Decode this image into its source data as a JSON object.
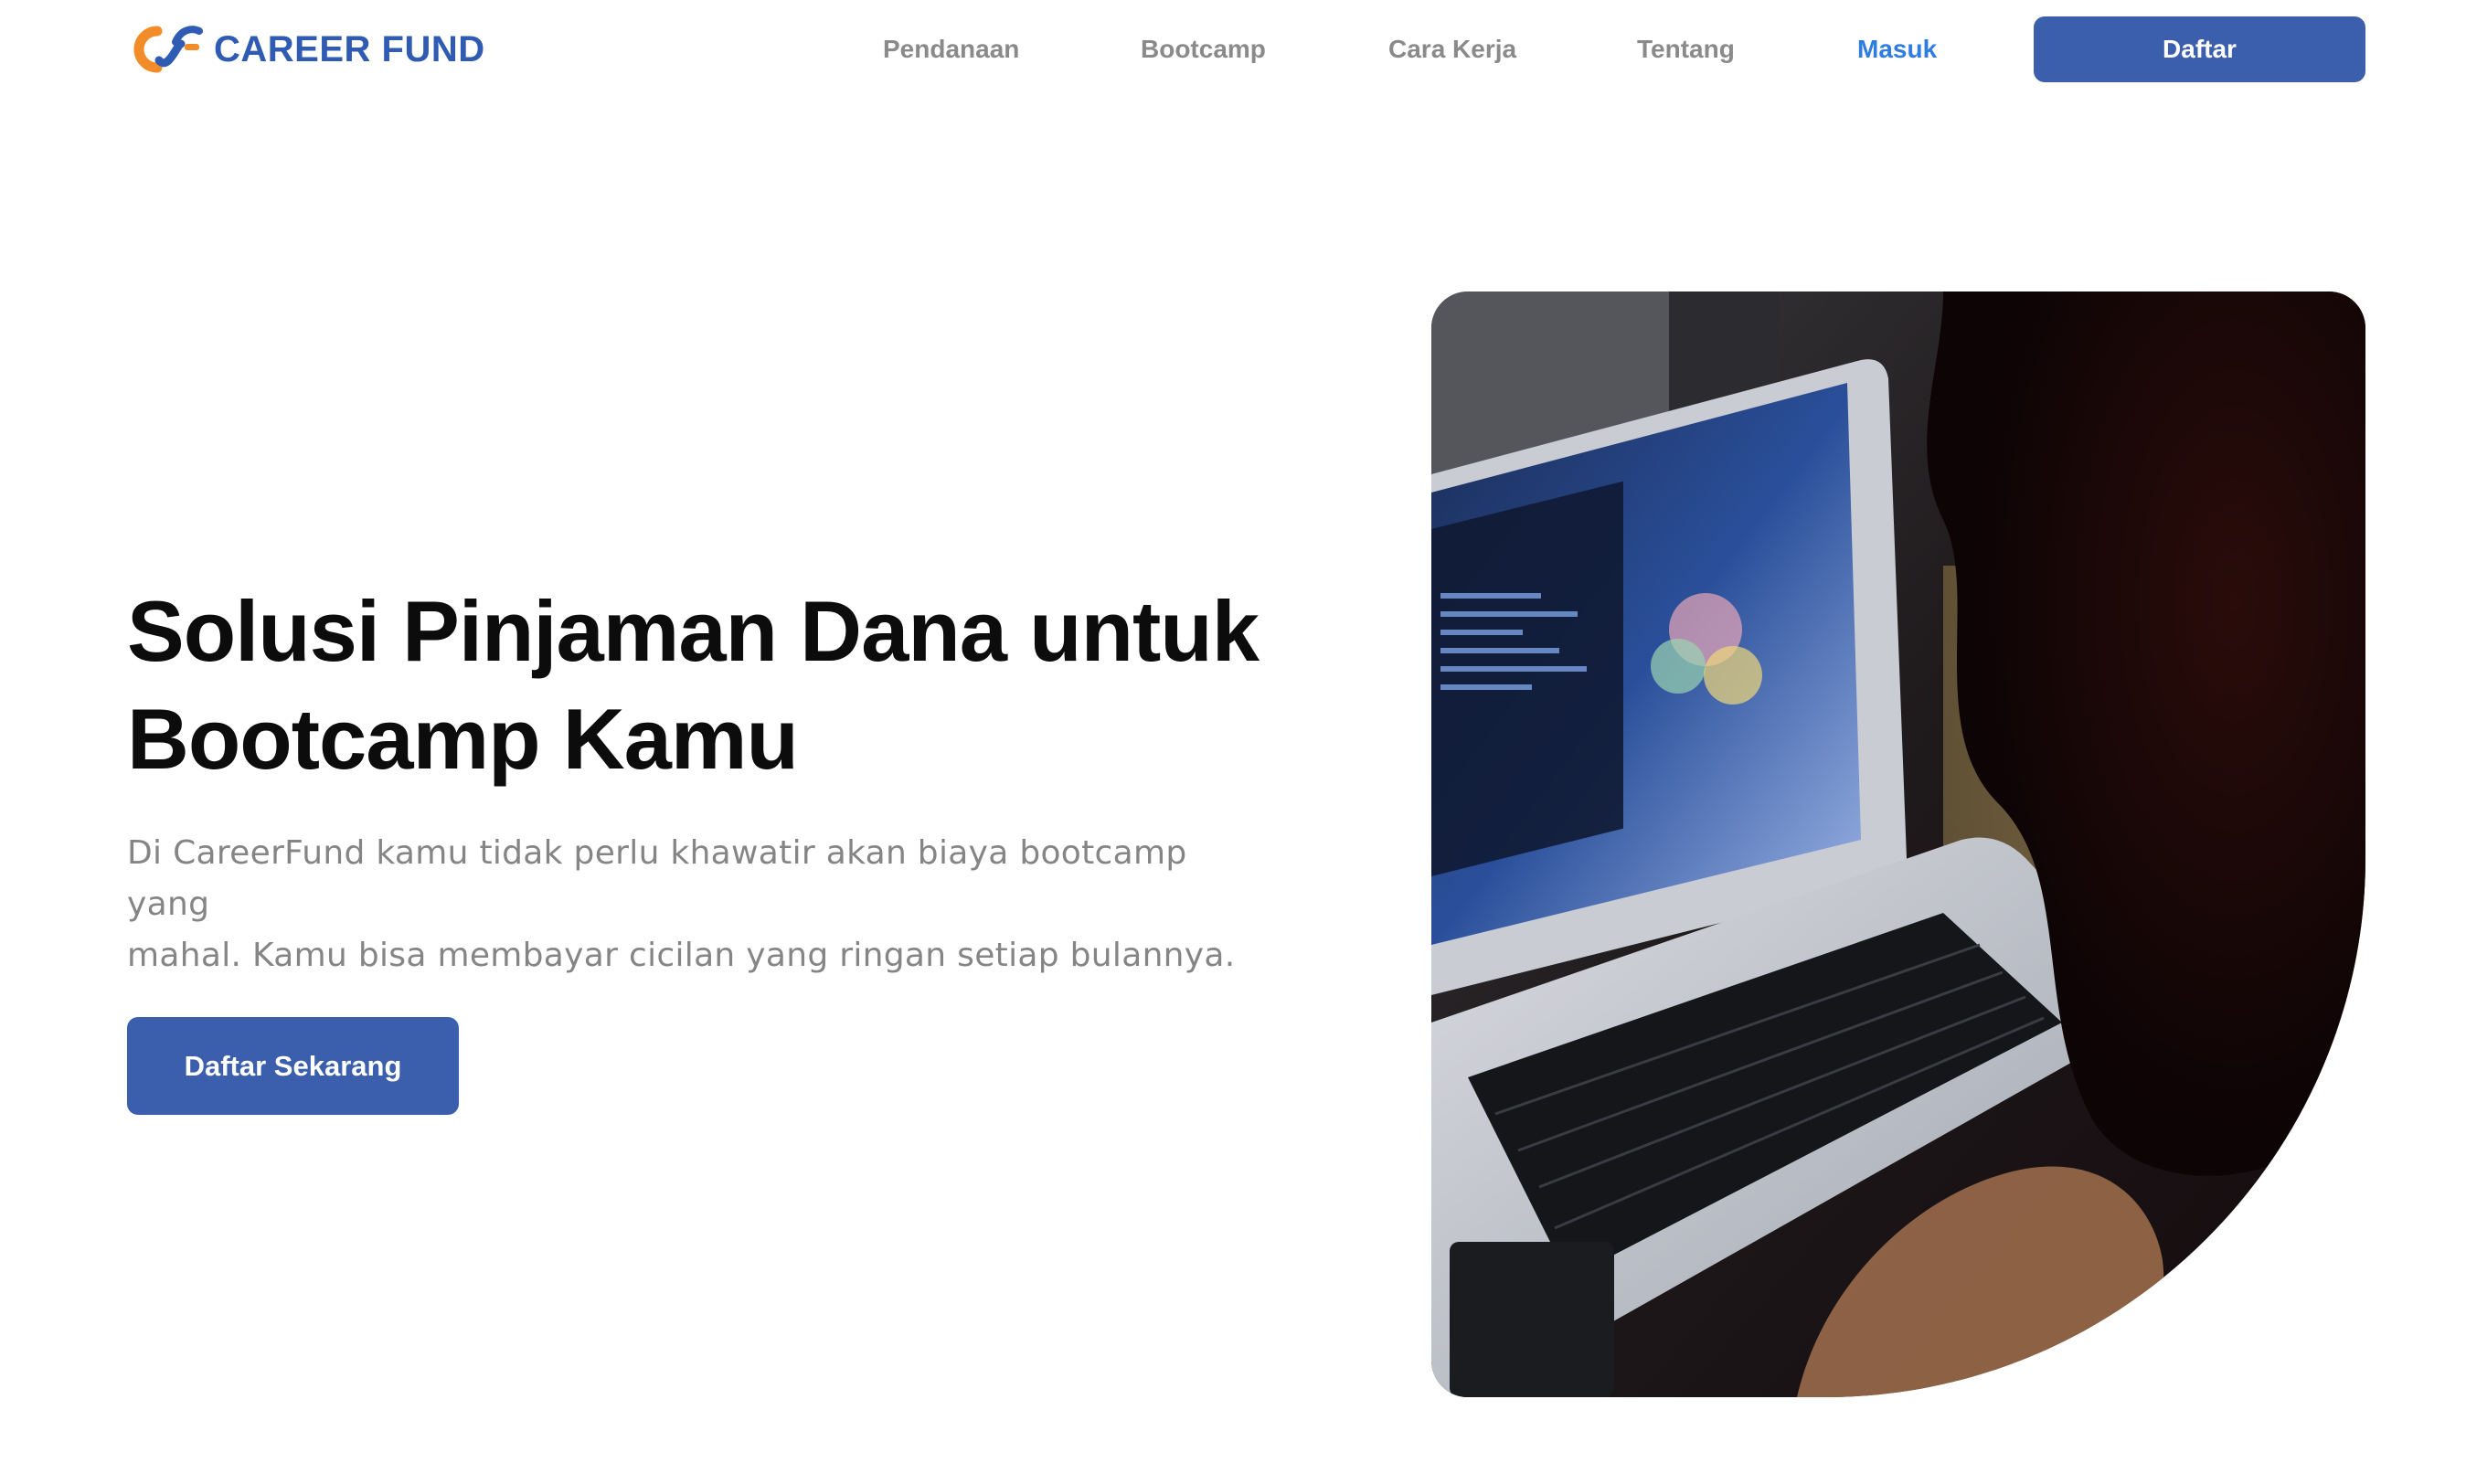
{
  "brand": {
    "name": "CAREER FUND",
    "logo_icon": "careerfund-logo-icon",
    "colors": {
      "orange": "#f28c28",
      "blue": "#2f5bb3"
    }
  },
  "nav": {
    "links": [
      {
        "label": "Pendanaan"
      },
      {
        "label": "Bootcamp"
      },
      {
        "label": "Cara Kerja"
      },
      {
        "label": "Tentang"
      }
    ],
    "login_label": "Masuk",
    "register_label": "Daftar"
  },
  "hero": {
    "title_line1": "Solusi Pinjaman Dana untuk",
    "title_line2": "Bootcamp Kamu",
    "subtitle_line1": "Di CareerFund kamu tidak perlu khawatir akan biaya bootcamp yang",
    "subtitle_line2": "mahal. Kamu bisa membayar cicilan yang ringan setiap bulannya.",
    "cta_label": "Daftar Sekarang",
    "image": "person-coding-on-laptop-photo"
  },
  "colors": {
    "primary": "#3b5fad",
    "active_link": "#2f7de1",
    "muted": "#8a8a8a",
    "text": "#0c0c0c"
  }
}
